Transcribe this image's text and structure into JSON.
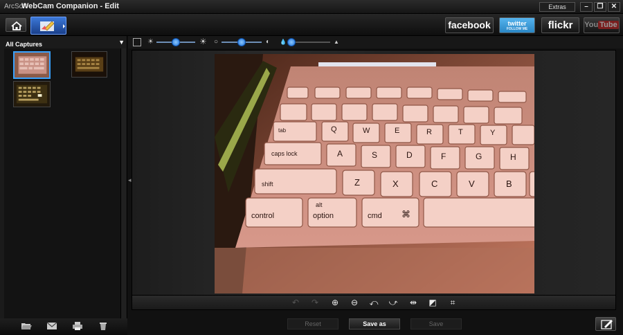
{
  "window": {
    "brand": "ArcSoft",
    "app_title": "WebCam Companion  - Edit",
    "extras_label": "Extras",
    "minimize": "–",
    "restore": "❐",
    "close": "✕"
  },
  "toolbar": {
    "home_icon": "home-icon",
    "edit_icon": "edit-brush-icon",
    "facebook": "facebook",
    "twitter": "twitter",
    "twitter_sub": "FOLLOW ME",
    "flickr": "flickr",
    "youtube_you": "You",
    "youtube_tube": "Tube"
  },
  "left_panel": {
    "captures_label": "All Captures",
    "dropdown_arrow": "▼",
    "thumbnails": [
      {
        "name": "capture-1",
        "selected": true
      },
      {
        "name": "capture-2",
        "selected": false
      },
      {
        "name": "capture-3",
        "selected": false
      }
    ],
    "bottom_icons": [
      "folder-open-icon",
      "email-icon",
      "print-icon",
      "trash-icon"
    ]
  },
  "adjustments": {
    "brightness_min": "☀",
    "brightness_max": "☀",
    "contrast_min": "○",
    "contrast_max": "◐",
    "saturation_min": "💧",
    "saturation_max": "▲",
    "brightness_value": 0.5,
    "contrast_value": 0.5,
    "saturation_value": 0.1
  },
  "edit_tools": [
    {
      "name": "undo-icon",
      "glyph": "↶",
      "enabled": false
    },
    {
      "name": "redo-icon",
      "glyph": "↷",
      "enabled": false
    },
    {
      "name": "zoom-in-icon",
      "glyph": "⊕",
      "enabled": true
    },
    {
      "name": "zoom-out-icon",
      "glyph": "⊖",
      "enabled": true
    },
    {
      "name": "rotate-left-icon",
      "glyph": "⤺",
      "enabled": true
    },
    {
      "name": "rotate-right-icon",
      "glyph": "⤻",
      "enabled": true
    },
    {
      "name": "flip-icon",
      "glyph": "⇹",
      "enabled": true
    },
    {
      "name": "fit-icon",
      "glyph": "◩",
      "enabled": true
    },
    {
      "name": "crop-icon",
      "glyph": "⌗",
      "enabled": true
    }
  ],
  "actions": {
    "reset": "Reset",
    "save_as": "Save as",
    "save": "Save"
  },
  "photo": {
    "keys": {
      "tab": "tab",
      "caps": "caps lock",
      "shift": "shift",
      "control": "control",
      "alt": "alt",
      "option": "option",
      "cmd": "cmd",
      "cmd_symbol": "⌘",
      "q": "Q",
      "w": "W",
      "e": "E",
      "r": "R",
      "t": "T",
      "y": "Y",
      "a": "A",
      "s": "S",
      "d": "D",
      "f": "F",
      "g": "G",
      "h": "H",
      "z": "Z",
      "x": "X",
      "c": "C",
      "v": "V",
      "b": "B"
    }
  }
}
